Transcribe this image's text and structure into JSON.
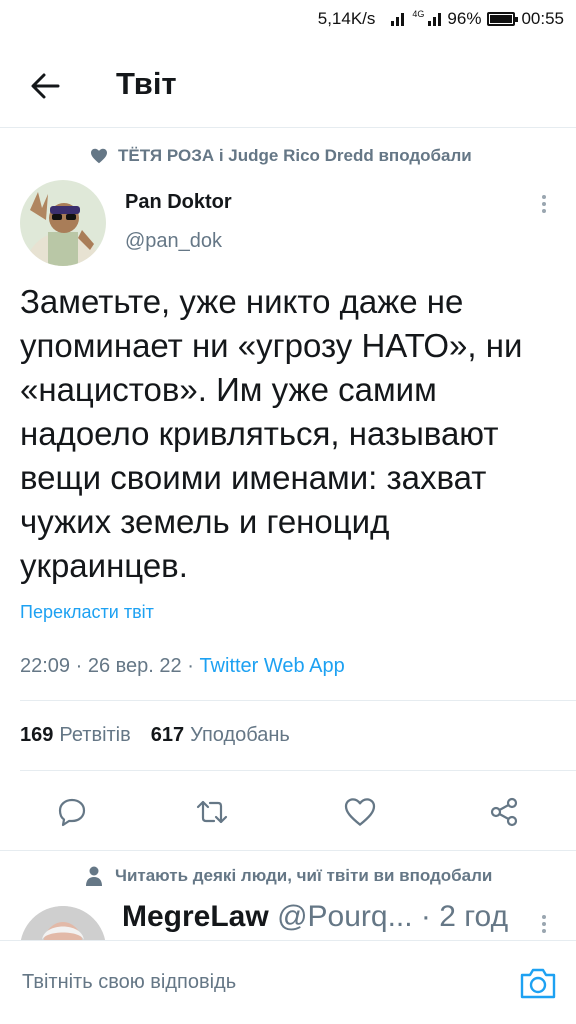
{
  "status_bar": {
    "speed": "5,14K/s",
    "network": "4G",
    "battery": "96%",
    "time": "00:55"
  },
  "header": {
    "title": "Твіт"
  },
  "social_context": {
    "text": "ТЁТЯ РОЗА і Judge Rico Dredd вподобали"
  },
  "tweet": {
    "author_name": "Pan Doktor",
    "author_handle": "@pan_dok",
    "text": "Заметьте, уже никто даже не упоминает ни «угрозу НАТО», ни «нацистов». Им уже самим надоело кривляться, называют вещи своими именами: захват чужих земель и геноцид украинцев.",
    "translate_label": "Перекласти твіт",
    "time": "22:09",
    "date": "26 вер. 22",
    "source": "Twitter Web App",
    "retweets_count": "169",
    "retweets_label": "Ретвітів",
    "likes_count": "617",
    "likes_label": "Уподобань"
  },
  "next_tweet": {
    "context": "Читають деякі люди, чиї твіти ви вподобали",
    "author_name": "MegreLaw",
    "author_handle": "@Pourq...",
    "time_ago": "2 год"
  },
  "reply": {
    "placeholder": "Твітніть свою відповідь"
  },
  "colors": {
    "accent": "#1da1f2",
    "muted": "#657786",
    "text": "#14171a",
    "divider": "#e6ecf0"
  }
}
